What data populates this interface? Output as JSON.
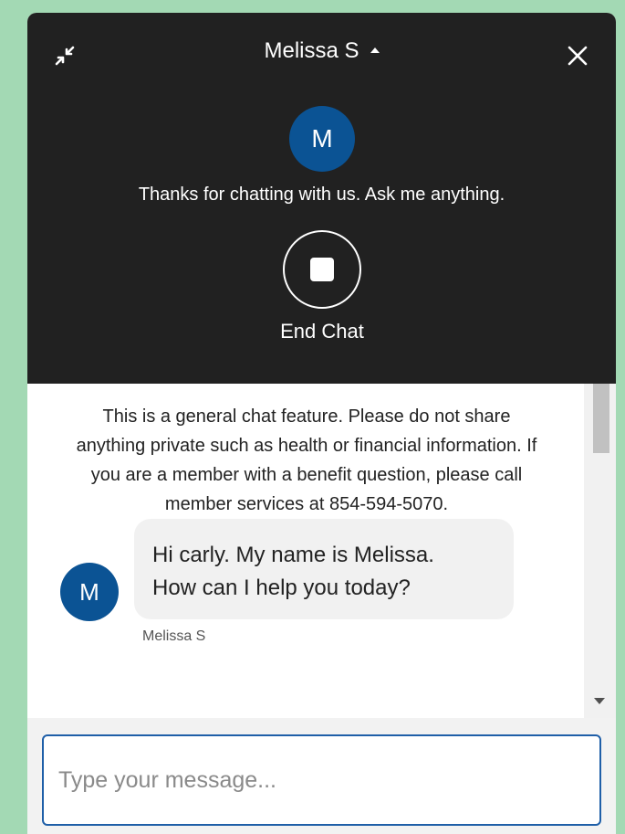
{
  "header": {
    "agent_name": "Melissa S",
    "avatar_initial": "M",
    "greeting": "Thanks for chatting with us. Ask me anything.",
    "end_chat_label": "End Chat",
    "icons": {
      "minimize": "collapse-arrows-icon",
      "caret": "caret-up-icon",
      "close": "close-icon",
      "end_chat": "stop-icon"
    }
  },
  "transcript": {
    "disclaimer_lines": [
      "This is a general chat feature. Please do not share",
      "anything private such as health or financial information. If",
      "you are a member with a benefit question, please call",
      "member services at 854-594-5070."
    ],
    "messages": [
      {
        "avatar_initial": "M",
        "lines": [
          "Hi carly. My name is Melissa.",
          "How can I help you today?"
        ],
        "sender": "Melissa S"
      }
    ]
  },
  "composer": {
    "placeholder": "Type your message..."
  },
  "colors": {
    "page_background": "#a3d9b4",
    "header_background": "#212121",
    "avatar_blue": "#0b5394",
    "input_border": "#1f5fa8"
  }
}
